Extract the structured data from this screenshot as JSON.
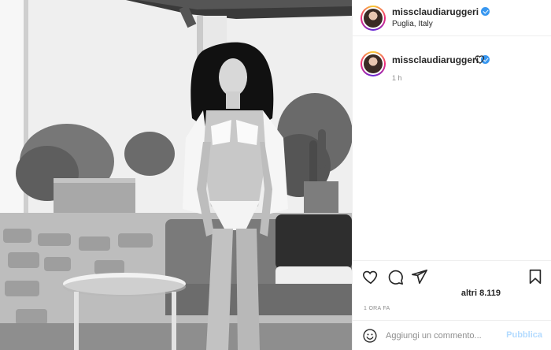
{
  "post": {
    "photo_alt": "Black-and-white photo of a woman standing under a pergola by wicker patio furniture",
    "header": {
      "username": "missclaudiaruggeri",
      "location": "Puglia, Italy",
      "verified": true
    },
    "caption": {
      "username": "missclaudiaruggeri",
      "time": "1 h"
    },
    "actions": {
      "like_icon": "heart-outline-icon",
      "comment_icon": "speech-bubble-icon",
      "share_icon": "paper-plane-icon",
      "save_icon": "bookmark-icon"
    },
    "likes": "altri 8.119",
    "posted_ago": "1 ORA FA",
    "comment_box": {
      "placeholder": "Aggiungi un commento...",
      "publish_label": "Pubblica"
    }
  },
  "colors": {
    "verified": "#3897f0",
    "publish_disabled": "#b3dbff",
    "muted_text": "#8e8e8e",
    "border": "#efefef"
  }
}
